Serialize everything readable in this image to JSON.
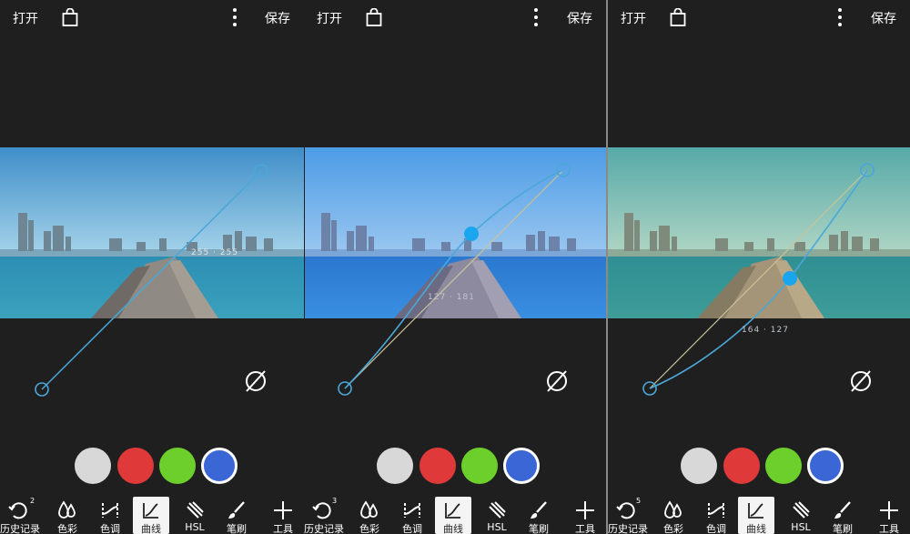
{
  "panels": [
    {
      "topbar": {
        "open_label": "打开",
        "save_label": "保存"
      },
      "curve_readout": "255 · 255",
      "history_count": "2",
      "tools": [
        "历史记录",
        "色彩",
        "色调",
        "曲线",
        "HSL",
        "笔刷",
        "工具"
      ],
      "active_tool": "曲线",
      "selected_swatch": "blue"
    },
    {
      "topbar": {
        "open_label": "打开",
        "save_label": "保存"
      },
      "curve_readout": "127 · 181",
      "history_count": "3",
      "tools": [
        "历史记录",
        "色彩",
        "色调",
        "曲线",
        "HSL",
        "笔刷",
        "工具"
      ],
      "active_tool": "曲线",
      "selected_swatch": "blue"
    },
    {
      "topbar": {
        "open_label": "打开",
        "save_label": "保存"
      },
      "curve_readout": "164 · 127",
      "history_count": "5",
      "tools": [
        "历史记录",
        "色彩",
        "色调",
        "曲线",
        "HSL",
        "笔刷",
        "工具"
      ],
      "active_tool": "曲线",
      "selected_swatch": "blue"
    }
  ],
  "swatches": [
    {
      "name": "white",
      "color": "#d9d8d9"
    },
    {
      "name": "red",
      "color": "#e0393a"
    },
    {
      "name": "green",
      "color": "#6dcf2c"
    },
    {
      "name": "blue",
      "color": "#3b66d6"
    }
  ],
  "colors": {
    "background": "#1f1e1f",
    "curve_line": "#4aa8d8",
    "curve_point": "#1aa6ee",
    "reference_line": "#c9c39a"
  }
}
